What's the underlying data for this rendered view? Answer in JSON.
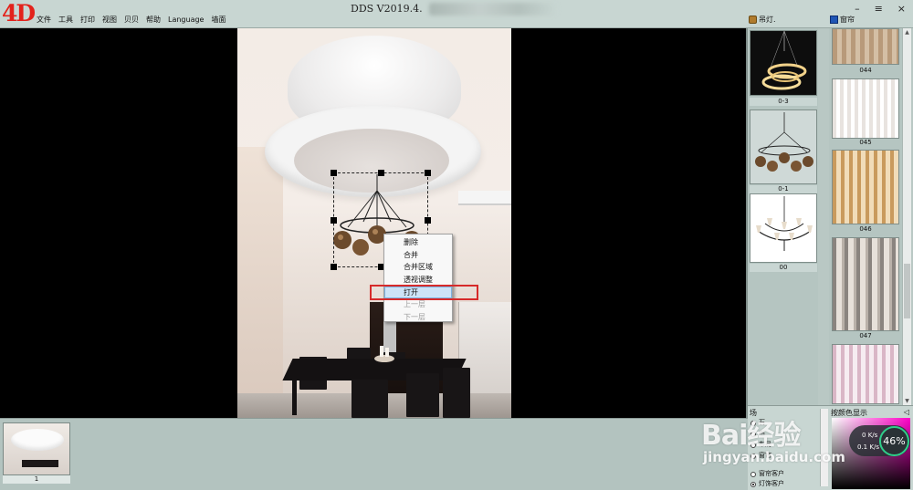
{
  "app": {
    "logo": "4D",
    "title": "DDS  V2019.4."
  },
  "menu": [
    "文件",
    "工具",
    "打印",
    "视图",
    "贝贝",
    "帮助",
    "Language",
    "墙面"
  ],
  "window_controls": [
    "–",
    "≡",
    "×"
  ],
  "panel_tabs": {
    "lamps": "吊灯.",
    "curtains": "窗帘"
  },
  "context_menu": {
    "items": [
      {
        "label": "删除",
        "enabled": true
      },
      {
        "label": "合并",
        "enabled": true
      },
      {
        "label": "合并区域",
        "enabled": true
      },
      {
        "label": "透视调整",
        "enabled": true
      },
      {
        "label": "打开",
        "enabled": true,
        "hovered": true
      },
      {
        "label": "上一层",
        "enabled": false
      },
      {
        "label": "下一层",
        "enabled": false
      }
    ]
  },
  "thumbnails": [
    {
      "label": "1"
    }
  ],
  "lamp_catalog": [
    {
      "label": "0-3"
    },
    {
      "label": "0-1"
    },
    {
      "label": "00"
    }
  ],
  "curtain_catalog": [
    {
      "label": "044"
    },
    {
      "label": "045"
    },
    {
      "label": "046"
    },
    {
      "label": "047"
    }
  ],
  "bottom_panel": {
    "title": "场",
    "options": [
      {
        "label": "石",
        "checked": false
      },
      {
        "label": "布",
        "checked": false
      },
      {
        "label": "布局",
        "checked": false
      },
      {
        "label": "窗帘",
        "checked": false
      },
      {
        "label": "窗帘客户",
        "checked": false
      },
      {
        "label": "灯饰客户",
        "checked": true
      }
    ]
  },
  "color_panel": {
    "title": "按颜色显示",
    "arrow": "◁"
  },
  "speed_widget": {
    "up": "0",
    "up_unit": "K/s",
    "down": "0.1",
    "down_unit": "K/s",
    "percent": "46%"
  },
  "watermark": {
    "brand": "Bai经验",
    "url": "jingyan.baidu.com"
  }
}
